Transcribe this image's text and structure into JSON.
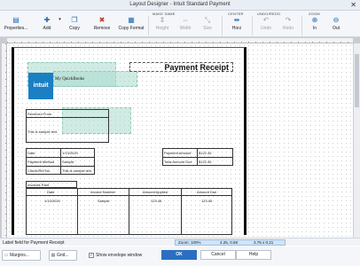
{
  "window": {
    "title": "Layout Designer - Intuit Standard Payment",
    "close_glyph": "✕"
  },
  "toolbar": {
    "groups": {
      "make_same": "MAKE SAME",
      "center": "CENTER",
      "undo_redo": "UNDO/REDO",
      "zoom": "ZOOM"
    },
    "buttons": {
      "properties": "Properties...",
      "add": "Add",
      "copy": "Copy",
      "remove": "Remove",
      "copy_format": "Copy Format",
      "height": "Height",
      "width": "Width",
      "size": "Size",
      "horz": "Horz",
      "undo": "Undo",
      "redo": "Redo",
      "zoom_in": "In",
      "zoom_out": "Out"
    }
  },
  "form": {
    "title": "Payment Receipt",
    "logo_text": "intuit",
    "company_name": "My QuickBooks",
    "received_from_label": "Received From",
    "received_from_value": "This is sample text.",
    "date_label": "Date",
    "date_value": "1/13/2020",
    "payment_method_label": "Payment Method",
    "payment_method_value": "Sample",
    "check_ref_label": "Check/Ref No.",
    "check_ref_value": "This is sample text.",
    "payment_amount_label": "Payment Amount",
    "payment_amount_value": "$122.45",
    "total_amount_due_label": "Total Amount Due",
    "total_amount_due_value": "$122.45",
    "invoices_paid_label": "Invoices Paid",
    "columns": [
      "Date",
      "Invoice Number",
      "Amount Applied",
      "Amount Due"
    ],
    "row": [
      "1/13/2020",
      "Sample",
      "123.45",
      "123.45"
    ]
  },
  "status": {
    "message": "Label field for Payment Receipt",
    "zoom": "Zoom: 100%",
    "position": "4.25, 0.59",
    "size": "3.75 x 0.21"
  },
  "bottom": {
    "margins": "Margins...",
    "grid": "Grid...",
    "show_envelope": "Show envelope window",
    "ok": "OK",
    "cancel": "Cancel",
    "help": "Help"
  },
  "colors": {
    "accent": "#2b6fc2",
    "field_tint": "#aadace",
    "logo": "#1b7fc4"
  }
}
